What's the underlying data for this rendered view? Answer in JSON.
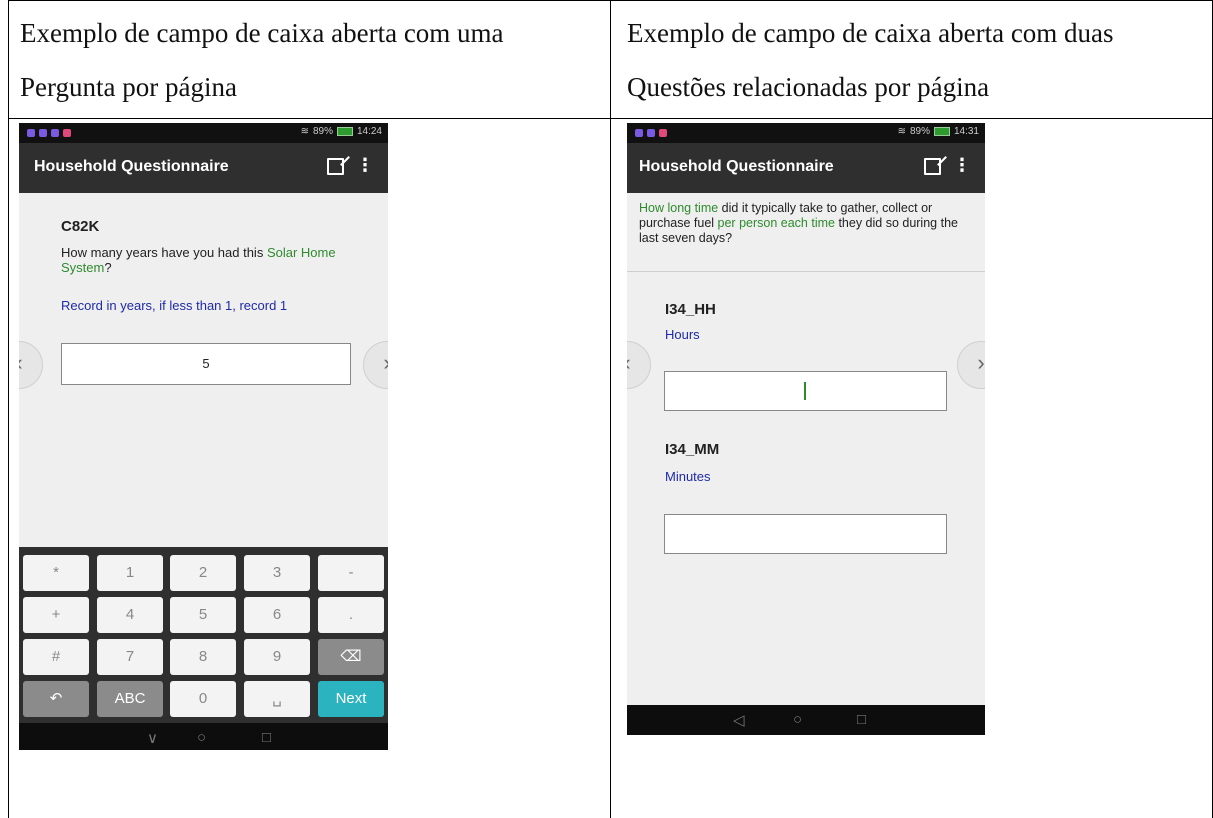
{
  "headers": {
    "left_line1": "Exemplo de campo de caixa aberta com uma",
    "left_line2": "Pergunta por página",
    "right_line1": "Exemplo de campo de caixa aberta com duas",
    "right_line2": "Questões relacionadas por página"
  },
  "left_phone": {
    "status_time": "14:24",
    "status_battery": "89%",
    "app_title": "Household Questionnaire",
    "question_code": "C82K",
    "question_part1": "How many years have you had this ",
    "question_highlight": "Solar Home System",
    "question_part2": "?",
    "instruction": "Record in years, if less than 1, record 1",
    "answer_value": "5",
    "keyboard": {
      "row1": [
        "*",
        "1",
        "2",
        "3",
        "-"
      ],
      "row2": [
        "+",
        "4",
        "5",
        "6",
        "."
      ],
      "row3": [
        "#",
        "7",
        "8",
        "9",
        "⌫"
      ],
      "row4": [
        "↶",
        "ABC",
        "0",
        "␣",
        "Next"
      ]
    },
    "nav": [
      "∨",
      "○",
      "□"
    ]
  },
  "right_phone": {
    "status_time": "14:31",
    "status_battery": "89%",
    "app_title": "Household Questionnaire",
    "intro_g1": "How long time",
    "intro_t1": " did it typically take to gather, collect or purchase fuel ",
    "intro_g2": "per person each time",
    "intro_t2": " they did so during the last seven days?",
    "q1_code": "I34_HH",
    "q1_label": "Hours",
    "q2_code": "I34_MM",
    "q2_label": "Minutes",
    "nav": [
      "◁",
      "○",
      "□"
    ]
  },
  "colors": {
    "green": "#2e8b2e",
    "instruction_blue": "#1e2aa8",
    "next_key": "#2bb3c0"
  }
}
